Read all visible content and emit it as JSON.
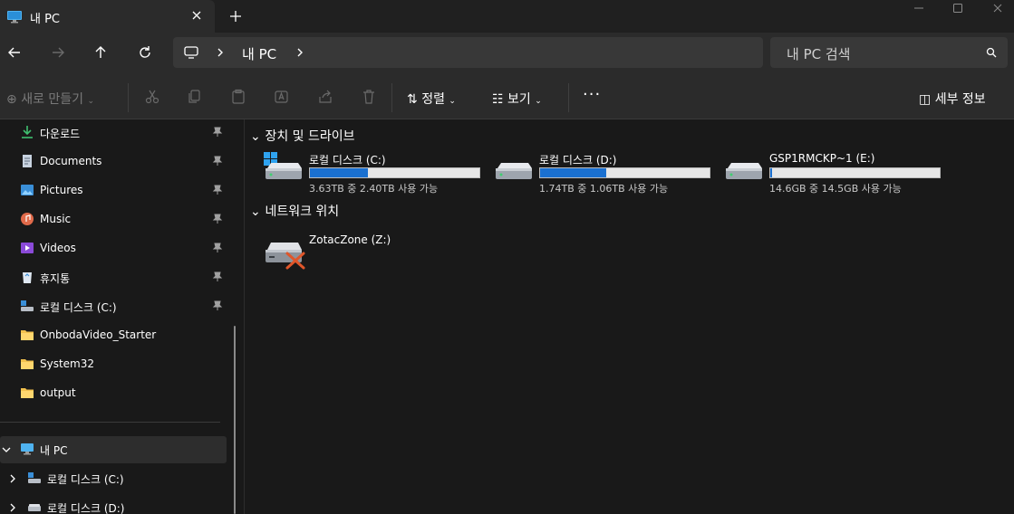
{
  "window": {
    "tab_title": "내 PC",
    "new_tab": "+"
  },
  "address": {
    "path": "내 PC",
    "search_placeholder": "내 PC 검색"
  },
  "commands": {
    "new": "새로 만들기",
    "sort": "정렬",
    "view": "보기",
    "more": "···",
    "details": "세부 정보"
  },
  "sidebar": {
    "quick_access": [
      {
        "label": "다운로드",
        "icon": "download-icon",
        "pinned": true
      },
      {
        "label": "Documents",
        "icon": "documents-icon",
        "pinned": true
      },
      {
        "label": "Pictures",
        "icon": "pictures-icon",
        "pinned": true
      },
      {
        "label": "Music",
        "icon": "music-icon",
        "pinned": true
      },
      {
        "label": "Videos",
        "icon": "videos-icon",
        "pinned": true
      },
      {
        "label": "휴지통",
        "icon": "recycle-bin-icon",
        "pinned": true
      },
      {
        "label": "로컬 디스크 (C:)",
        "icon": "drive-c-icon",
        "pinned": true
      },
      {
        "label": "OnbodaVideo_Starter",
        "icon": "folder-icon",
        "pinned": false
      },
      {
        "label": "System32",
        "icon": "folder-icon",
        "pinned": false
      },
      {
        "label": "output",
        "icon": "folder-icon",
        "pinned": false
      }
    ],
    "tree": [
      {
        "label": "내 PC",
        "icon": "pc-icon"
      },
      {
        "label": "로컬 디스크 (C:)",
        "icon": "drive-c-icon"
      },
      {
        "label": "로컬 디스크 (D:)",
        "icon": "drive-icon"
      }
    ]
  },
  "main": {
    "devices_header": "장치 및 드라이브",
    "network_header": "네트워크 위치",
    "drives": [
      {
        "name": "로컬 디스크 (C:)",
        "info": "3.63TB 중 2.40TB 사용 가능",
        "used_fraction": 0.34
      },
      {
        "name": "로컬 디스크 (D:)",
        "info": "1.74TB 중 1.06TB 사용 가능",
        "used_fraction": 0.39
      },
      {
        "name": "GSP1RMCKP~1 (E:)",
        "info": "14.6GB 중 14.5GB 사용 가능",
        "used_fraction": 0.01
      }
    ],
    "network": [
      {
        "name": "ZotacZone (Z:)"
      }
    ]
  },
  "colors": {
    "accent": "#1a70d0",
    "background": "#191919",
    "toolbar": "#2b2b2b"
  }
}
